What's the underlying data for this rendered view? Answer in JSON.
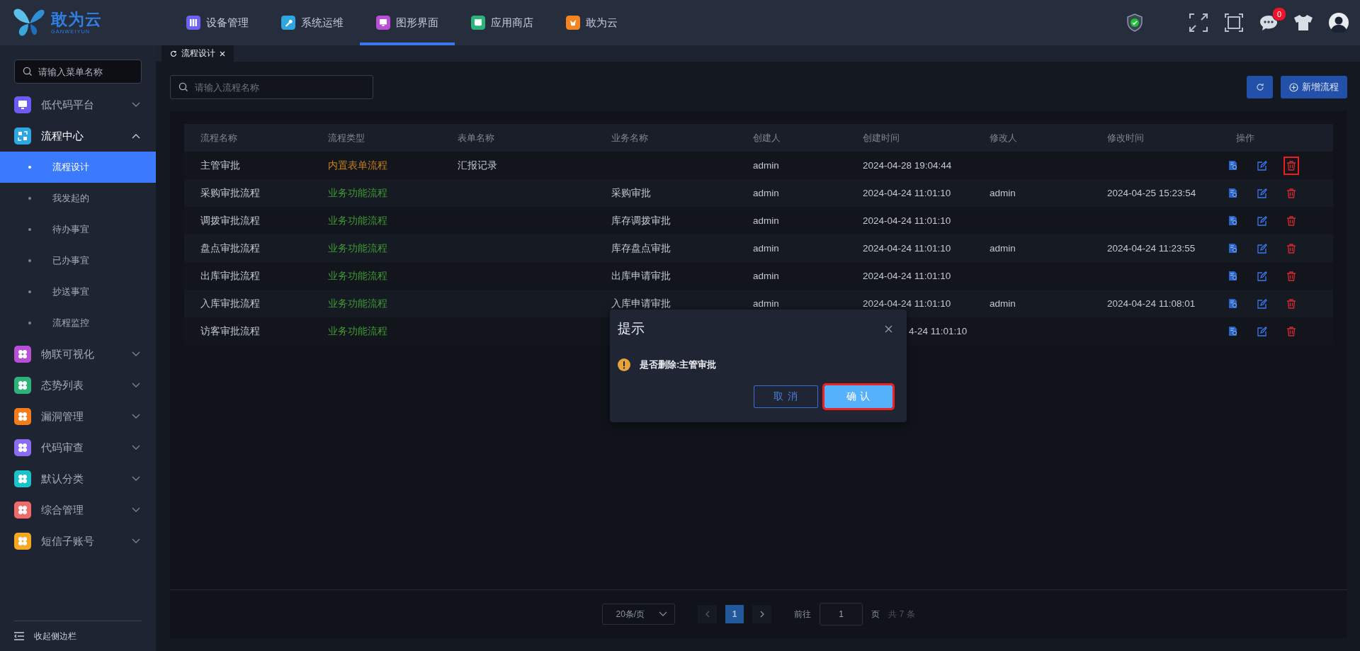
{
  "logo": {
    "name": "敢为云",
    "subtitle": "GANWEIYUN"
  },
  "top_nav": [
    {
      "label": "设备管理",
      "color": "#6c63f5",
      "selected": false
    },
    {
      "label": "系统运维",
      "color": "#2ea7e0",
      "selected": false
    },
    {
      "label": "图形界面",
      "color": "#b84fd6",
      "selected": true
    },
    {
      "label": "应用商店",
      "color": "#2db37a",
      "selected": false
    },
    {
      "label": "敢为云",
      "color": "#f5841f",
      "selected": false
    }
  ],
  "header": {
    "notification_count": "0"
  },
  "sidebar": {
    "search": {
      "placeholder": "请输入菜单名称"
    },
    "items": [
      {
        "label": "低代码平台",
        "color": "#6c5cf5",
        "expanded": false
      },
      {
        "label": "流程中心",
        "color": "#2ea7e0",
        "expanded": true,
        "children": [
          {
            "label": "流程设计",
            "selected": true
          },
          {
            "label": "我发起的",
            "selected": false
          },
          {
            "label": "待办事宜",
            "selected": false
          },
          {
            "label": "已办事宜",
            "selected": false
          },
          {
            "label": "抄送事宜",
            "selected": false
          },
          {
            "label": "流程监控",
            "selected": false
          }
        ]
      },
      {
        "label": "物联可视化",
        "color": "#b84fd6",
        "expanded": false
      },
      {
        "label": "态势列表",
        "color": "#2db37a",
        "expanded": false
      },
      {
        "label": "漏洞管理",
        "color": "#f37d1a",
        "expanded": false
      },
      {
        "label": "代码审查",
        "color": "#8b6cf0",
        "expanded": false
      },
      {
        "label": "默认分类",
        "color": "#19c3c9",
        "expanded": false
      },
      {
        "label": "综合管理",
        "color": "#f06a6a",
        "expanded": false
      },
      {
        "label": "短信子账号",
        "color": "#f5a623",
        "expanded": false
      }
    ],
    "collapse": "收起侧边栏"
  },
  "tabs": [
    {
      "label": "流程设计",
      "selected": true
    }
  ],
  "search": {
    "placeholder": "请输入流程名称"
  },
  "toolbar": {
    "add_button": "新增流程"
  },
  "table": {
    "columns": [
      "流程名称",
      "流程类型",
      "表单名称",
      "业务名称",
      "创建人",
      "创建时间",
      "修改人",
      "修改时间",
      "操作"
    ],
    "rows": [
      {
        "name": "主管审批",
        "type": {
          "text": "内置表单流程",
          "color": "#c8801a"
        },
        "form": "汇报记录",
        "creator": "admin",
        "created": "2024-04-28 19:04:44",
        "delete_highlighted": true
      },
      {
        "name": "采购审批流程",
        "type": {
          "text": "业务功能流程",
          "color": "#3f9a35"
        },
        "business": "采购审批",
        "creator": "admin",
        "created": "2024-04-24 11:01:10",
        "modifier": "admin",
        "modified": "2024-04-25 15:23:54",
        "delete_highlighted": false
      },
      {
        "name": "调拨审批流程",
        "type": {
          "text": "业务功能流程",
          "color": "#3f9a35"
        },
        "business": "库存调拨审批",
        "creator": "admin",
        "created": "2024-04-24 11:01:10",
        "delete_highlighted": false
      },
      {
        "name": "盘点审批流程",
        "type": {
          "text": "业务功能流程",
          "color": "#3f9a35"
        },
        "business": "库存盘点审批",
        "creator": "admin",
        "created": "2024-04-24 11:01:10",
        "modifier": "admin",
        "modified": "2024-04-24 11:23:55",
        "delete_highlighted": false
      },
      {
        "name": "出库审批流程",
        "type": {
          "text": "业务功能流程",
          "color": "#3f9a35"
        },
        "business": "出库申请审批",
        "creator": "admin",
        "created": "2024-04-24 11:01:10",
        "delete_highlighted": false
      },
      {
        "name": "入库审批流程",
        "type": {
          "text": "业务功能流程",
          "color": "#3f9a35"
        },
        "business": "入库申请审批",
        "creator": "admin",
        "created": "2024-04-24 11:01:10",
        "modifier": "admin",
        "modified": "2024-04-24 11:08:01",
        "delete_highlighted": false
      },
      {
        "name": "访客审批流程",
        "type": {
          "text": "业务功能流程",
          "color": "#3f9a35"
        },
        "created": "4-24 11:01:10",
        "created_clipped": true,
        "delete_highlighted": false
      }
    ]
  },
  "pagination": {
    "page_size": "20条/页",
    "pages": [
      {
        "label": "1",
        "selected": true
      }
    ],
    "goto_label": "前往",
    "goto_value": "1",
    "page_unit": "页",
    "total": "共 7 条"
  },
  "dialog": {
    "title": "提示",
    "message": "是否删除:主管审批",
    "buttons": [
      {
        "label": "取 消",
        "kind": "secondary",
        "highlighted": false
      },
      {
        "label": "确 认",
        "kind": "primary",
        "highlighted": true
      }
    ]
  }
}
